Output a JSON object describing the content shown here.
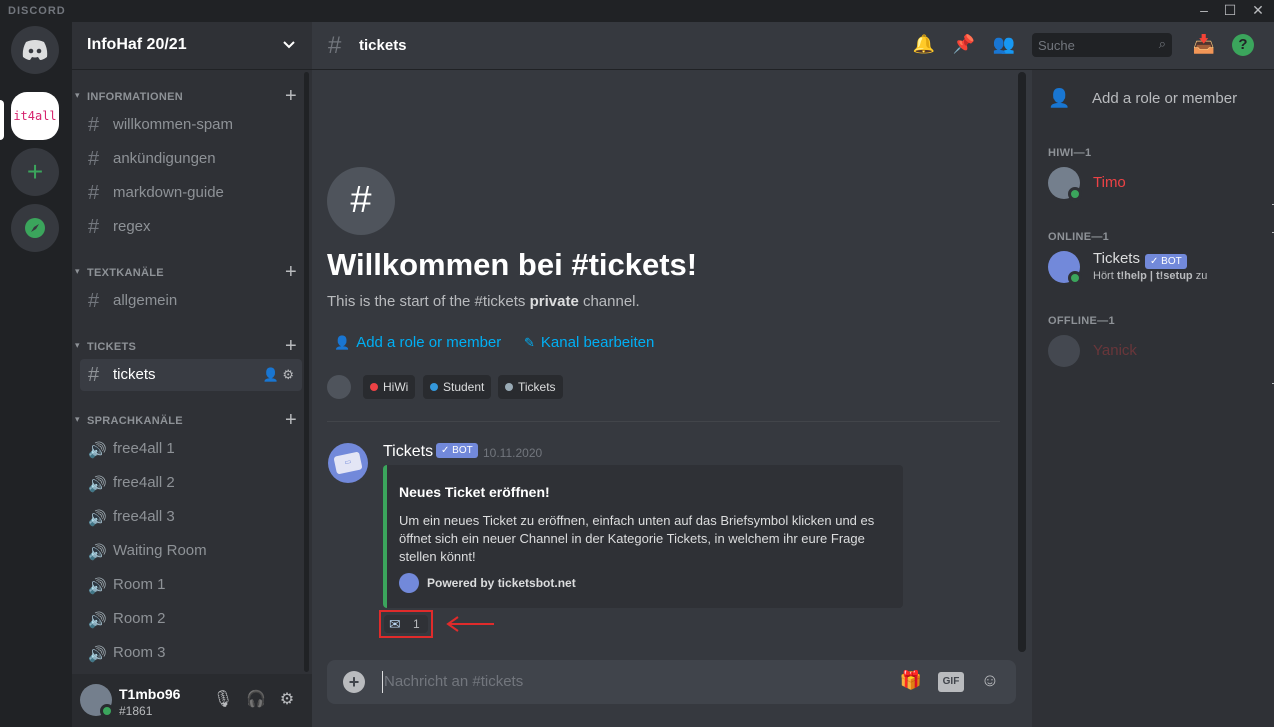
{
  "app": {
    "brand": "DISCORD"
  },
  "guilds": {
    "server_label": "it4all"
  },
  "server": {
    "name": "InfoHaf 20/21"
  },
  "categories": [
    {
      "label": "INFORMATIONEN",
      "channels": [
        "willkommen-spam",
        "ankündigungen",
        "markdown-guide",
        "regex"
      ]
    },
    {
      "label": "TEXTKANÄLE",
      "channels": [
        "allgemein"
      ]
    },
    {
      "label": "TICKETS",
      "channels": [
        "tickets"
      ]
    },
    {
      "label": "SPRACHKANÄLE",
      "channels": [
        "free4all 1",
        "free4all 2",
        "free4all 3",
        "Waiting Room",
        "Room 1",
        "Room 2",
        "Room 3"
      ]
    }
  ],
  "user": {
    "name": "T1mbo96",
    "tag": "#1861"
  },
  "channel": {
    "name": "tickets"
  },
  "search": {
    "placeholder": "Suche"
  },
  "welcome": {
    "title": "Willkommen bei #tickets!",
    "sub_before": "This is the start of the #tickets ",
    "sub_bold": "private",
    "sub_after": " channel.",
    "link_add": "Add a role or member",
    "link_edit": "Kanal bearbeiten",
    "roles": [
      {
        "name": "HiWi",
        "color": "#ed4245"
      },
      {
        "name": "Student",
        "color": "#3498db"
      },
      {
        "name": "Tickets",
        "color": "#99aab5"
      }
    ]
  },
  "message": {
    "author": "Tickets",
    "badge": "✓ BOT",
    "time": "10.11.2020",
    "embed_title": "Neues Ticket eröffnen!",
    "embed_desc": "Um ein neues Ticket zu eröffnen, einfach unten auf das Briefsymbol klicken und es öffnet sich ein neuer Channel in der Kategorie Tickets, in welchem ihr eure Frage stellen könnt!",
    "embed_footer": "Powered by ticketsbot.net",
    "embed_color": "#3ba55c",
    "reaction_count": "1"
  },
  "composer": {
    "placeholder": "Nachricht an #tickets",
    "gif": "GIF"
  },
  "members": {
    "add_role": "Add a role or member",
    "groups": [
      {
        "header": "HIWI—1",
        "name": "Timo",
        "color": "#ed4245",
        "sub": ""
      },
      {
        "header": "ONLINE—1",
        "name": "Tickets",
        "color": "#dcddde",
        "badge": "✓ BOT",
        "sub_a": "Hört ",
        "sub_b": "t!help | t!setup",
        "sub_c": " zu"
      },
      {
        "header": "OFFLINE—1",
        "name": "Yanick",
        "color": "#ed4245"
      }
    ]
  }
}
